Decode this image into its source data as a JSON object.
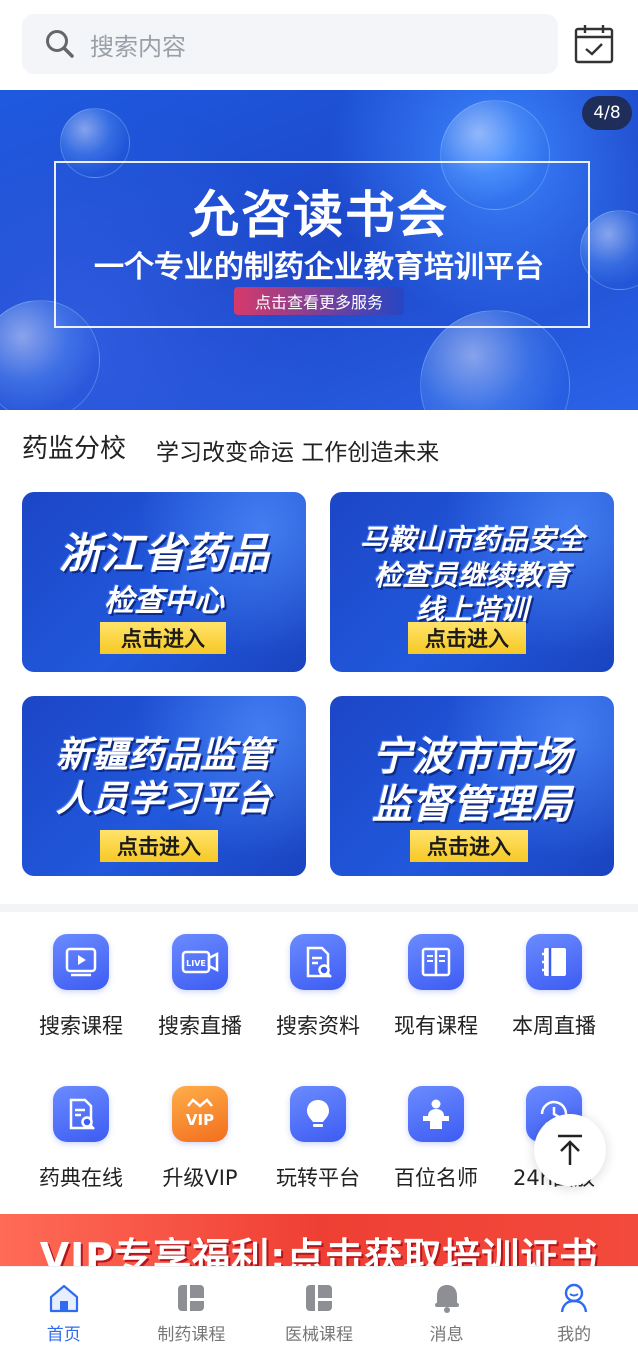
{
  "search": {
    "placeholder": "搜索内容"
  },
  "banner": {
    "title": "允咨读书会",
    "subtitle": "一个专业的制药企业教育培训平台",
    "button": "点击查看更多服务",
    "counter": "4/8"
  },
  "section": {
    "title": "药监分校",
    "subtitle": "学习改变命运 工作创造未来"
  },
  "cards": [
    {
      "line1": "浙江省药品",
      "line2": "检查中心",
      "line3": "",
      "button": "点击进入"
    },
    {
      "line1": "马鞍山市药品安全",
      "line2": "检查员继续教育",
      "line3": "线上培训",
      "button": "点击进入"
    },
    {
      "line1": "新疆药品监管",
      "line2": "人员学习平台",
      "line3": "",
      "button": "点击进入"
    },
    {
      "line1": "宁波市市场",
      "line2": "监督管理局",
      "line3": "",
      "button": "点击进入"
    }
  ],
  "grid": [
    {
      "label": "搜索课程",
      "icon": "video-play-icon"
    },
    {
      "label": "搜索直播",
      "icon": "live-camera-icon",
      "badge": "LIVE"
    },
    {
      "label": "搜索资料",
      "icon": "document-search-icon"
    },
    {
      "label": "现有课程",
      "icon": "open-book-icon"
    },
    {
      "label": "本周直播",
      "icon": "notebook-icon"
    },
    {
      "label": "药典在线",
      "icon": "document-search-icon"
    },
    {
      "label": "升级VIP",
      "icon": "vip-crown-icon",
      "badge": "VIP"
    },
    {
      "label": "玩转平台",
      "icon": "lightbulb-icon"
    },
    {
      "label": "百位名师",
      "icon": "teacher-podium-icon"
    },
    {
      "label": "24h回放",
      "icon": "replay-clock-icon",
      "badge": "24"
    }
  ],
  "vip_strip": {
    "text": "VIP专享福利:点击获取培训证书"
  },
  "nav": [
    {
      "label": "首页",
      "icon": "home-icon",
      "active": true
    },
    {
      "label": "制药课程",
      "icon": "course-icon"
    },
    {
      "label": "医械课程",
      "icon": "course-icon"
    },
    {
      "label": "消息",
      "icon": "bell-icon"
    },
    {
      "label": "我的",
      "icon": "profile-icon"
    }
  ],
  "colors": {
    "accent": "#2f6bf0",
    "banner_blue": "#1d47c9",
    "card_button_yellow": "#f7c825",
    "vip_red": "#ef3f34"
  }
}
